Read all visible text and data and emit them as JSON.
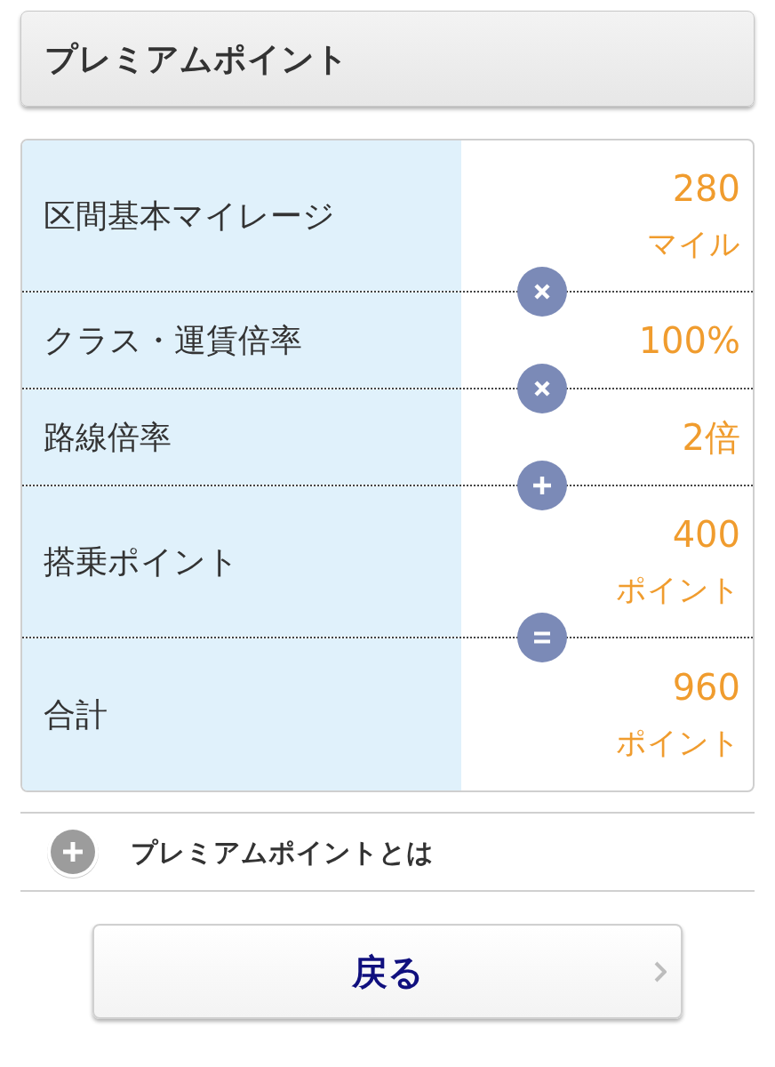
{
  "header": {
    "title": "プレミアムポイント"
  },
  "calculation": {
    "rows": [
      {
        "label": "区間基本マイレージ",
        "value": "280",
        "unit": "マイル",
        "operator": {
          "kind": "multiply"
        }
      },
      {
        "label": "クラス・運賃倍率",
        "value": "100%",
        "operator": {
          "kind": "multiply"
        }
      },
      {
        "label": "路線倍率",
        "value": "2倍",
        "operator": {
          "kind": "plus"
        }
      },
      {
        "label": "搭乗ポイント",
        "value": "400",
        "unit": "ポイント",
        "operator": {
          "kind": "equals"
        }
      },
      {
        "label": "合計",
        "value": "960",
        "unit": "ポイント"
      }
    ]
  },
  "info_section": {
    "label": "プレミアムポイントとは",
    "expanded": false
  },
  "back_button": {
    "label": "戻る"
  }
}
